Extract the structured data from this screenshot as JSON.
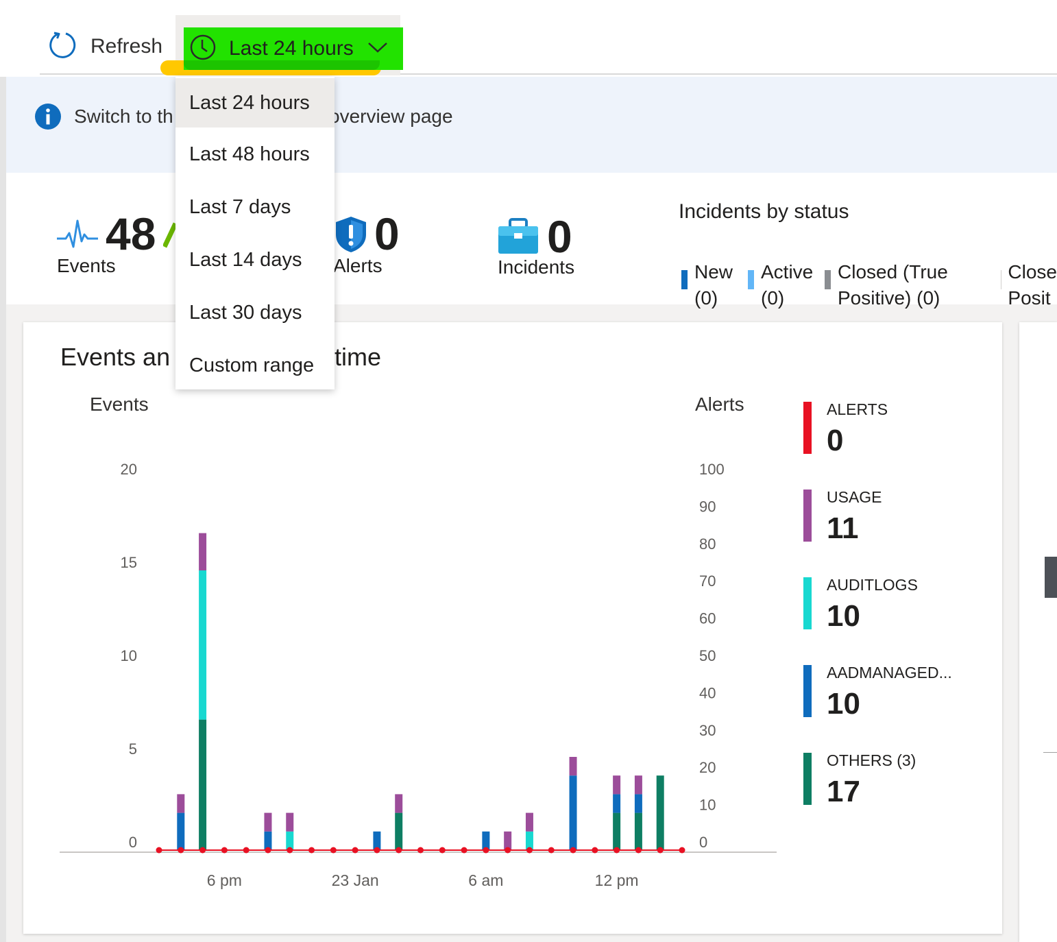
{
  "toolbar": {
    "refresh_label": "Refresh",
    "time_range_label": "Last 24 hours"
  },
  "time_menu": {
    "options": [
      "Last 24 hours",
      "Last 48 hours",
      "Last 7 days",
      "Last 14 days",
      "Last 30 days",
      "Custom range"
    ],
    "selected": "Last 24 hours"
  },
  "banner": {
    "text_start": "Switch to th",
    "text_end": "overview page"
  },
  "stats": {
    "events": {
      "value": "48",
      "label": "Events"
    },
    "alerts": {
      "value": "0",
      "label": "Alerts"
    },
    "incidents": {
      "value": "0",
      "label": "Incidents"
    }
  },
  "incidents_by_status": {
    "title": "Incidents by status",
    "items": [
      {
        "line1": "New",
        "line2": "(0)",
        "color": "#0f6cbd"
      },
      {
        "line1": "Active",
        "line2": "(0)",
        "color": "#62b6f7"
      },
      {
        "line1": "Closed (True",
        "line2": "Positive) (0)",
        "color": "#8a8d91"
      },
      {
        "line1": "Close",
        "line2": "Posit",
        "color": "#d2d0ce"
      }
    ]
  },
  "chart_card": {
    "title_start": "Events an",
    "title_end": "time",
    "left_axis_title": "Events",
    "right_axis_title": "Alerts"
  },
  "series_legend": [
    {
      "name": "ALERTS",
      "value": "0",
      "color": "#e81123"
    },
    {
      "name": "USAGE",
      "value": "11",
      "color": "#9c4d9a"
    },
    {
      "name": "AUDITLOGS",
      "value": "10",
      "color": "#18d8d0"
    },
    {
      "name": "AADMANAGED...",
      "value": "10",
      "color": "#0f6cbd"
    },
    {
      "name": "OTHERS (3)",
      "value": "17",
      "color": "#0e7e63"
    }
  ],
  "chart_data": {
    "type": "bar",
    "x": [
      1,
      2,
      3,
      4,
      5,
      6,
      7,
      8,
      9,
      10,
      11,
      12,
      13,
      14,
      15,
      16,
      17,
      18,
      19,
      20,
      21,
      22,
      23,
      24,
      25
    ],
    "x_ticks": [
      {
        "label": "6 pm",
        "at": 4
      },
      {
        "label": "23 Jan",
        "at": 10
      },
      {
        "label": "6 am",
        "at": 16
      },
      {
        "label": "12 pm",
        "at": 22
      }
    ],
    "y_left": {
      "title": "Events",
      "ticks": [
        0,
        5,
        10,
        15,
        20
      ],
      "ylim": [
        0,
        20
      ]
    },
    "y_right": {
      "title": "Alerts",
      "ticks": [
        0,
        10,
        20,
        30,
        40,
        50,
        60,
        70,
        80,
        90,
        100
      ],
      "ylim": [
        0,
        100
      ]
    },
    "series": [
      {
        "name": "OTHERS (3)",
        "color": "#0e7e63",
        "values": [
          0,
          0,
          7,
          0,
          0,
          0,
          0,
          0,
          0,
          0,
          0,
          2,
          0,
          0,
          0,
          0,
          0,
          0,
          0,
          0,
          0,
          2,
          2,
          4,
          0
        ]
      },
      {
        "name": "AADMANAGED...",
        "color": "#0f6cbd",
        "values": [
          0,
          2,
          0,
          0,
          0,
          1,
          0,
          0,
          0,
          0,
          1,
          0,
          0,
          0,
          0,
          1,
          0,
          0,
          0,
          4,
          0,
          1,
          1,
          0,
          0
        ]
      },
      {
        "name": "AUDITLOGS",
        "color": "#18d8d0",
        "values": [
          0,
          0,
          8,
          0,
          0,
          0,
          1,
          0,
          0,
          0,
          0,
          0,
          0,
          0,
          0,
          0,
          0,
          1,
          0,
          0,
          0,
          0,
          0,
          0,
          0
        ]
      },
      {
        "name": "USAGE",
        "color": "#9c4d9a",
        "values": [
          0,
          1,
          2,
          0,
          0,
          1,
          1,
          0,
          0,
          0,
          0,
          1,
          0,
          0,
          0,
          0,
          1,
          1,
          0,
          1,
          0,
          1,
          1,
          0,
          0
        ]
      },
      {
        "name": "ALERTS",
        "color": "#e81123",
        "axis": "right",
        "values": [
          0,
          0,
          0,
          0,
          0,
          0,
          0,
          0,
          0,
          0,
          0,
          0,
          0,
          0,
          0,
          0,
          0,
          0,
          0,
          0,
          0,
          0,
          0,
          0,
          0
        ]
      }
    ],
    "grid": false,
    "legend": "right"
  }
}
